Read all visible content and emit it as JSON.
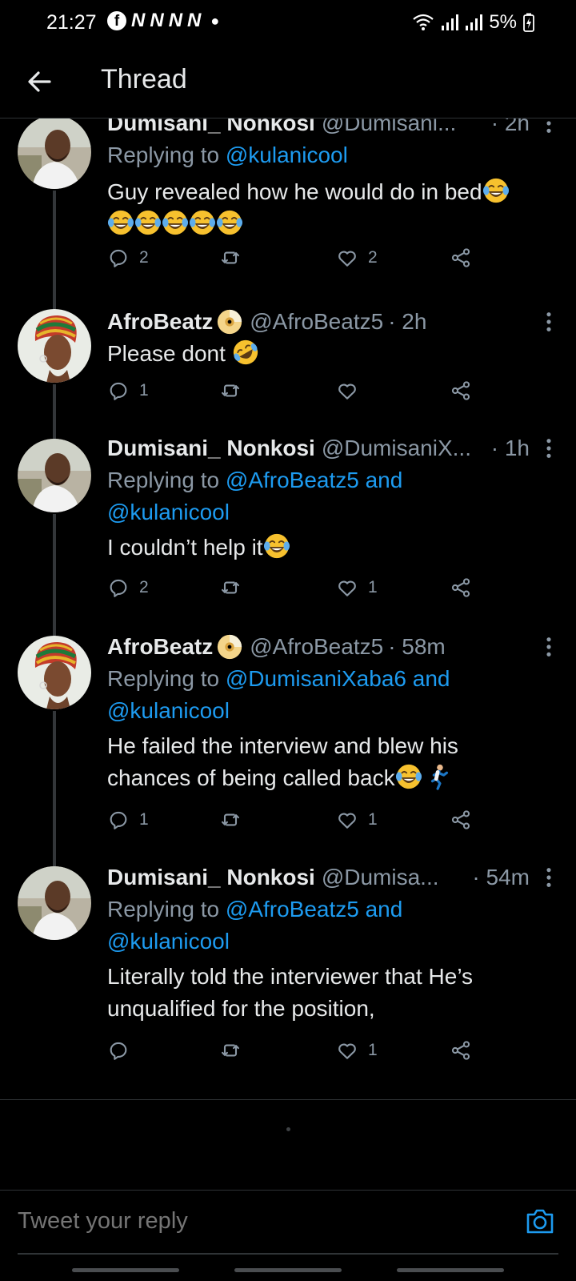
{
  "status_bar": {
    "time": "21:27",
    "notification_letters": [
      "N",
      "N",
      "N",
      "N"
    ],
    "battery": "5%"
  },
  "header": {
    "title": "Thread"
  },
  "tweets": [
    {
      "display_name": "Dumisani_ Nonkosi",
      "handle": "@Dumisani...",
      "time": "· 2h",
      "replying_prefix": "Replying to",
      "mentions_line1": "@kulanicool",
      "mentions_line2": "",
      "text_line1": "Guy revealed how he would do in bed",
      "text_line2": "",
      "replies": "2",
      "retweets": "",
      "likes": "2"
    },
    {
      "display_name": "AfroBeatz",
      "handle": "@AfroBeatz5",
      "time": "· 2h",
      "text_line1": "Please dont",
      "replies": "1",
      "retweets": "",
      "likes": ""
    },
    {
      "display_name": "Dumisani_ Nonkosi",
      "handle": "@DumisaniX...",
      "time": "· 1h",
      "replying_prefix": "Replying to",
      "mentions_line1": "@AfroBeatz5 and",
      "mentions_line2": "@kulanicool",
      "text_line1": "I couldn’t help it",
      "replies": "2",
      "retweets": "",
      "likes": "1"
    },
    {
      "display_name": "AfroBeatz",
      "handle": "@AfroBeatz5",
      "time": "· 58m",
      "replying_prefix": "Replying to",
      "mentions_line1": "@DumisaniXaba6 and",
      "mentions_line2": "@kulanicool",
      "text_line1": "He failed the interview and blew his",
      "text_line2": "chances of being called back",
      "replies": "1",
      "retweets": "",
      "likes": "1"
    },
    {
      "display_name": "Dumisani_ Nonkosi",
      "handle": "@Dumisa...",
      "time": "· 54m",
      "replying_prefix": "Replying to",
      "mentions_line1": "@AfroBeatz5 and",
      "mentions_line2": "@kulanicool",
      "text_line1": "Literally told the interviewer that He’s",
      "text_line2": "unqualified for the position,",
      "replies": "",
      "retweets": "",
      "likes": "1"
    }
  ],
  "composer": {
    "placeholder": "Tweet your reply"
  },
  "icons": {
    "back": "arrow-left-icon",
    "more": "more-vertical-icon",
    "reply": "reply-icon",
    "retweet": "retweet-icon",
    "like": "heart-icon",
    "share": "share-icon",
    "camera": "camera-icon",
    "laugh_emoji": "tears-of-joy-emoji",
    "rofl_emoji": "rolling-on-floor-laughing-emoji",
    "runner_emoji": "person-running-emoji",
    "cd_emoji": "optical-disc-emoji"
  },
  "colors": {
    "background": "#000000",
    "accent": "#1d9bf0",
    "secondary_text": "#8b98a5",
    "primary_text": "#e7e9ea",
    "divider": "#2f3336"
  }
}
